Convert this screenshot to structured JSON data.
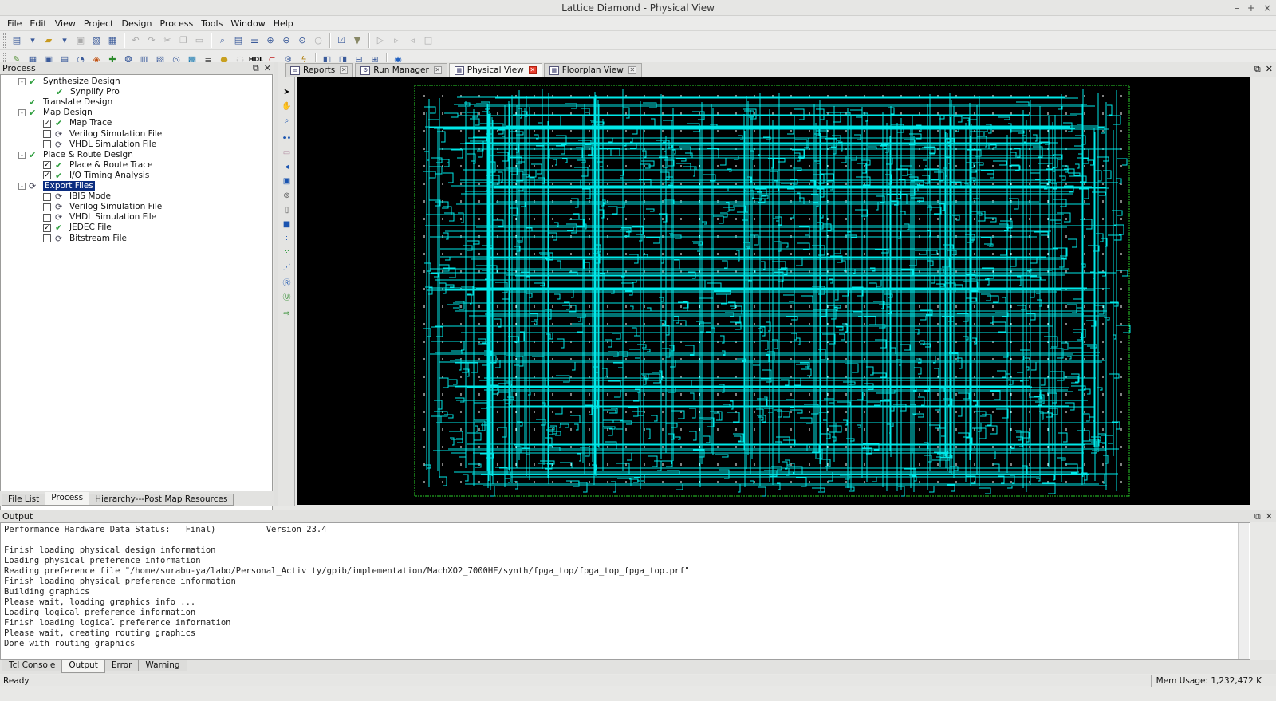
{
  "window": {
    "title": "Lattice Diamond - Physical View",
    "controls": [
      "–",
      "+",
      "×"
    ]
  },
  "menu": [
    "File",
    "Edit",
    "View",
    "Project",
    "Design",
    "Process",
    "Tools",
    "Window",
    "Help"
  ],
  "left_panel": {
    "title": "Process",
    "tree": [
      {
        "label": "Synthesize Design",
        "level": 0,
        "icon": "check-icon",
        "expander": "-"
      },
      {
        "label": "Synplify Pro",
        "level": 1,
        "icon": "check-icon"
      },
      {
        "label": "Translate Design",
        "level": 0,
        "icon": "check-icon"
      },
      {
        "label": "Map Design",
        "level": 0,
        "icon": "check-icon",
        "expander": "-"
      },
      {
        "label": "Map Trace",
        "level": 1,
        "icon": "check-icon",
        "checkbox": true
      },
      {
        "label": "Verilog Simulation File",
        "level": 1,
        "icon": "refresh-icon",
        "checkbox": false
      },
      {
        "label": "VHDL Simulation File",
        "level": 1,
        "icon": "refresh-icon",
        "checkbox": false
      },
      {
        "label": "Place & Route Design",
        "level": 0,
        "icon": "check-icon",
        "expander": "-"
      },
      {
        "label": "Place & Route Trace",
        "level": 1,
        "icon": "check-icon",
        "checkbox": true
      },
      {
        "label": "I/O Timing Analysis",
        "level": 1,
        "icon": "check-icon",
        "checkbox": true
      },
      {
        "label": "Export Files",
        "level": 0,
        "icon": "refresh-icon",
        "expander": "-",
        "selected": true
      },
      {
        "label": "IBIS Model",
        "level": 1,
        "icon": "refresh-icon",
        "checkbox": false
      },
      {
        "label": "Verilog Simulation File",
        "level": 1,
        "icon": "refresh-icon",
        "checkbox": false
      },
      {
        "label": "VHDL Simulation File",
        "level": 1,
        "icon": "refresh-icon",
        "checkbox": false
      },
      {
        "label": "JEDEC File",
        "level": 1,
        "icon": "check-icon",
        "checkbox": true
      },
      {
        "label": "Bitstream File",
        "level": 1,
        "icon": "refresh-icon",
        "checkbox": false
      }
    ],
    "tabs": [
      {
        "label": "File List",
        "active": false
      },
      {
        "label": "Process",
        "active": true
      },
      {
        "label": "Hierarchy---Post Map Resources",
        "active": false
      }
    ]
  },
  "doc_tabs": [
    {
      "label": "Reports",
      "active": false
    },
    {
      "label": "Run Manager",
      "active": false
    },
    {
      "label": "Physical View",
      "active": true
    },
    {
      "label": "Floorplan View",
      "active": false
    }
  ],
  "output": {
    "title": "Output",
    "lines": [
      "Performance Hardware Data Status:   Final)          Version 23.4",
      "",
      "Finish loading physical design information",
      "Loading physical preference information",
      "Reading preference file \"/home/surabu-ya/labo/Personal_Activity/gpib/implementation/MachXO2_7000HE/synth/fpga_top/fpga_top_fpga_top.prf\"",
      "Finish loading physical preference information",
      "Building graphics",
      "Please wait, loading graphics info ...",
      "Loading logical preference information",
      "Finish loading logical preference information",
      "Please wait, creating routing graphics",
      "Done with routing graphics"
    ],
    "tabs": [
      {
        "label": "Tcl Console",
        "active": false
      },
      {
        "label": "Output",
        "active": true
      },
      {
        "label": "Error",
        "active": false
      },
      {
        "label": "Warning",
        "active": false
      }
    ]
  },
  "status": {
    "text": "Ready",
    "mem": "Mem Usage:  1,232,472 K"
  },
  "colors": {
    "routing": "#00e8e8",
    "boundary": "#2ad02a",
    "canvas": "#000000",
    "selection": "#0b2d80"
  }
}
